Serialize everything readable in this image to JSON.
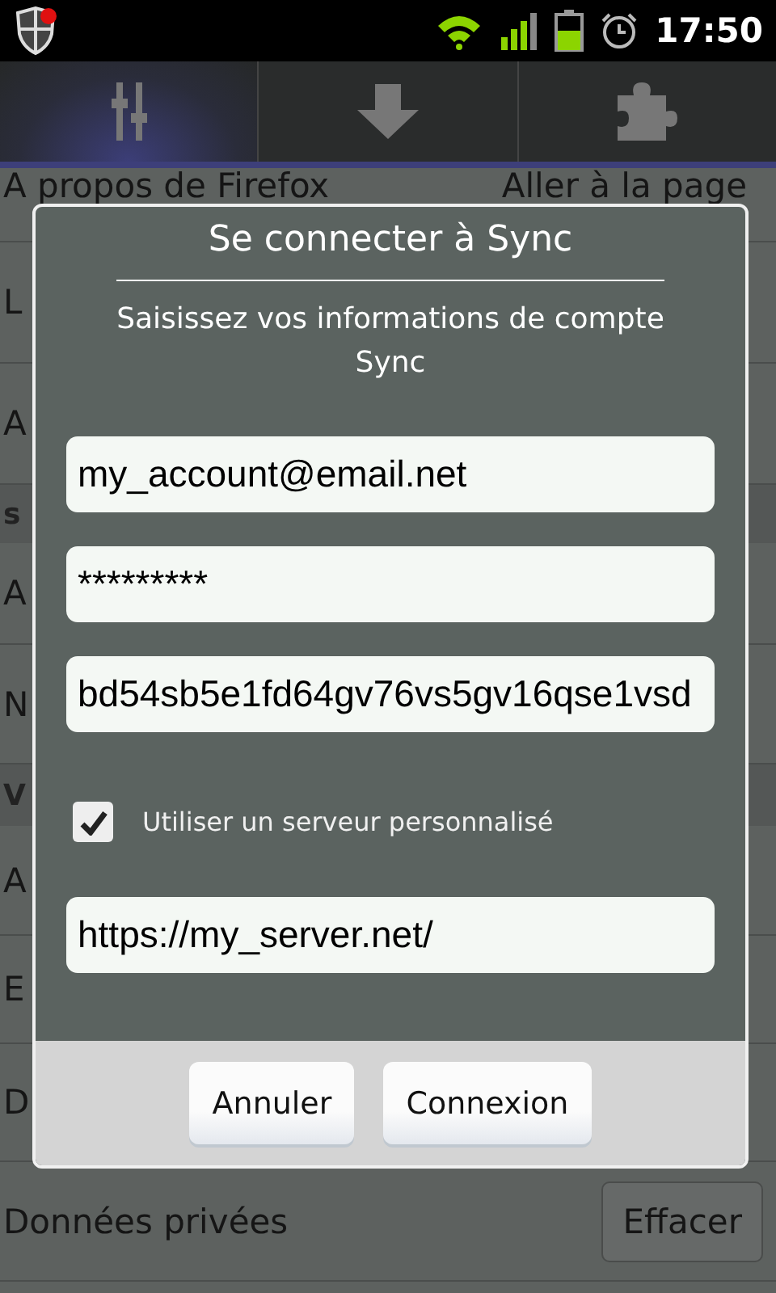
{
  "status_bar": {
    "time": "17:50"
  },
  "tabs": [
    {
      "kind": "sliders",
      "selected": true
    },
    {
      "kind": "download",
      "selected": false
    },
    {
      "kind": "puzzle",
      "selected": false
    }
  ],
  "settings": [
    {
      "kind": "row",
      "label": "A propos de Firefox",
      "button": "Aller à la page"
    },
    {
      "kind": "row",
      "label": "L"
    },
    {
      "kind": "row",
      "label": "A"
    },
    {
      "kind": "header",
      "label": "s"
    },
    {
      "kind": "row",
      "label": "A"
    },
    {
      "kind": "row",
      "label": "N"
    },
    {
      "kind": "header",
      "label": "V"
    },
    {
      "kind": "row",
      "label": "A"
    },
    {
      "kind": "row",
      "label": "E"
    },
    {
      "kind": "row",
      "label": "D"
    },
    {
      "kind": "row",
      "label": "Données privées",
      "button": "Effacer"
    }
  ],
  "dialog": {
    "title": "Se connecter à Sync",
    "message": "Saisissez vos informations de compte Sync",
    "fields": [
      {
        "value": "my_account@email.net"
      },
      {
        "value": "*********"
      },
      {
        "value": "bd54sb5e1fd64gv76vs5gv16qse1vsd"
      }
    ],
    "checkbox": {
      "label": "Utiliser un serveur personnalisé",
      "checked": true
    },
    "server_field": {
      "value": "https://my_server.net/"
    },
    "buttons": [
      "Annuler",
      "Connexion"
    ]
  }
}
